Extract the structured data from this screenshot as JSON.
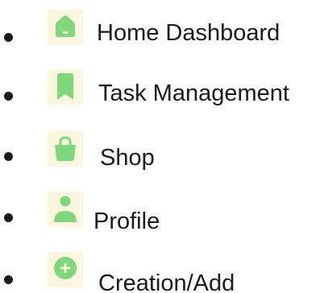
{
  "colors": {
    "icon_background": "#fbf6de",
    "icon_green": "#7fd87c",
    "icon_inner": "#fbf6de",
    "text": "#1a1a1a"
  },
  "nav": {
    "items": [
      {
        "icon": "home-icon",
        "label": "Home Dashboard"
      },
      {
        "icon": "bookmark-icon",
        "label": "Task Management"
      },
      {
        "icon": "shopping-bag-icon",
        "label": "Shop"
      },
      {
        "icon": "person-icon",
        "label": "Profile"
      },
      {
        "icon": "plus-circle-icon",
        "label": "Creation/Add"
      }
    ]
  }
}
